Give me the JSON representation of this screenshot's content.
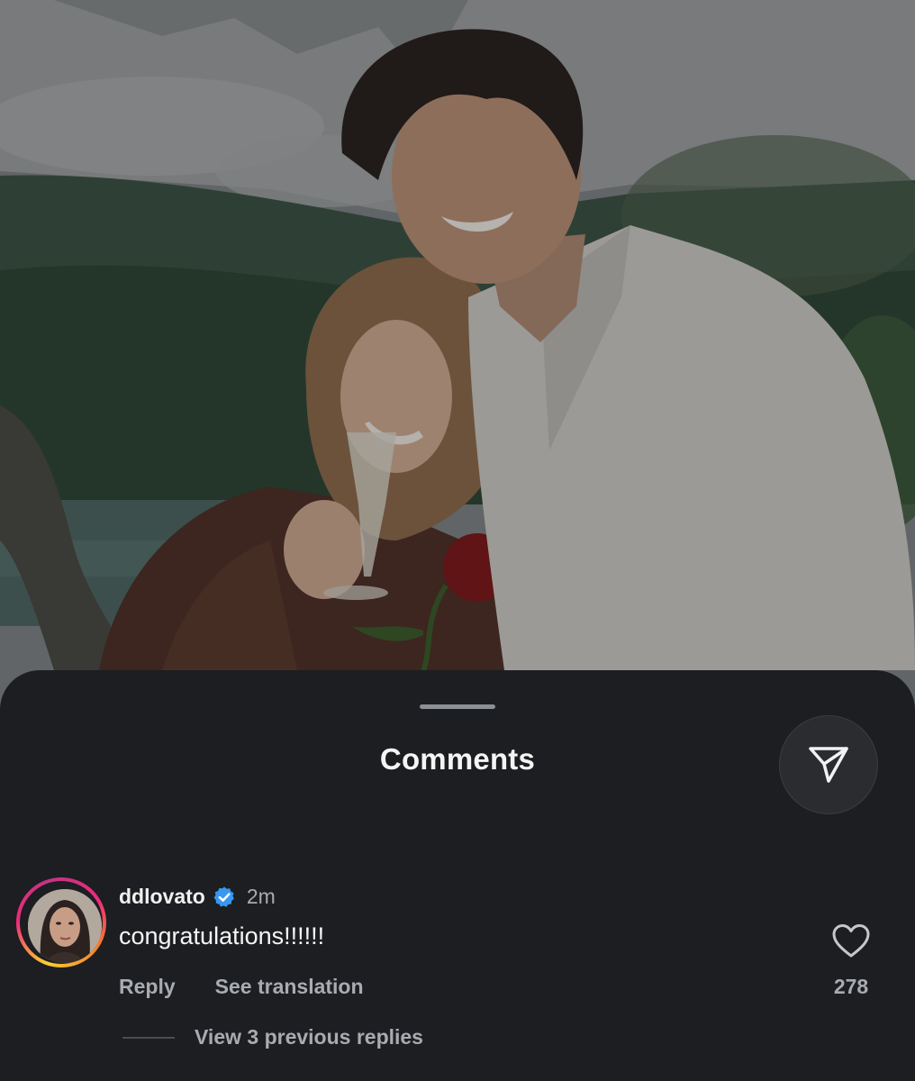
{
  "sheet": {
    "title": "Comments"
  },
  "icons": {
    "share": "paper-plane-icon",
    "verified": "verified-badge-icon",
    "like": "heart-outline-icon"
  },
  "comment": {
    "username": "ddlovato",
    "verified": true,
    "time": "2m",
    "text": "congratulations!!!!!!",
    "reply_label": "Reply",
    "translate_label": "See translation",
    "like_count": "278",
    "view_replies_label": "View 3 previous replies"
  },
  "colors": {
    "sheet_bg": "#1c1e21",
    "verified_blue": "#3897f0",
    "secondary_text": "#a8abb0"
  }
}
